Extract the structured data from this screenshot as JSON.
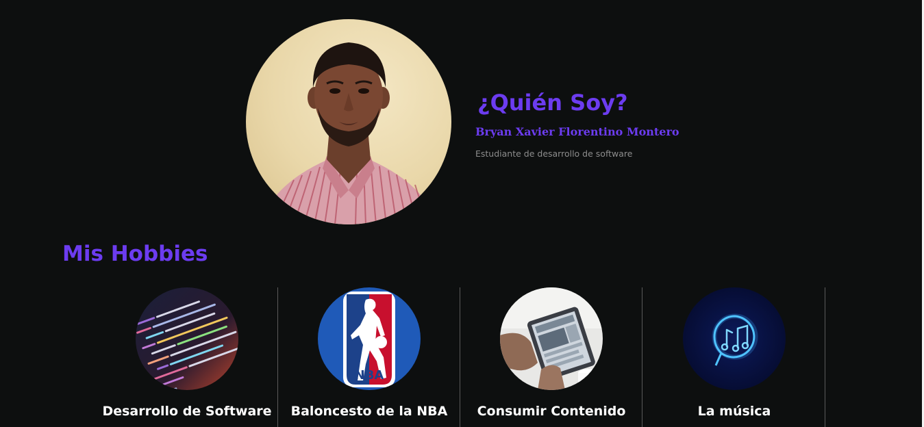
{
  "about": {
    "title": "¿Quién Soy?",
    "name": "Bryan Xavier Florentino Montero",
    "role": "Estudiante de desarrollo de software"
  },
  "hobbies": {
    "title": "Mis Hobbies",
    "items": [
      {
        "label": "Desarrollo de Software",
        "icon": "code-image"
      },
      {
        "label": "Baloncesto de la NBA",
        "icon": "nba-logo"
      },
      {
        "label": "Consumir Contenido",
        "icon": "tablet-image"
      },
      {
        "label": "La música",
        "icon": "music-note-icon"
      }
    ]
  },
  "colors": {
    "background": "#0d0f0f",
    "accent": "#6c3cf0",
    "muted_text": "#8d8d8d",
    "divider": "#5b5b5b"
  }
}
